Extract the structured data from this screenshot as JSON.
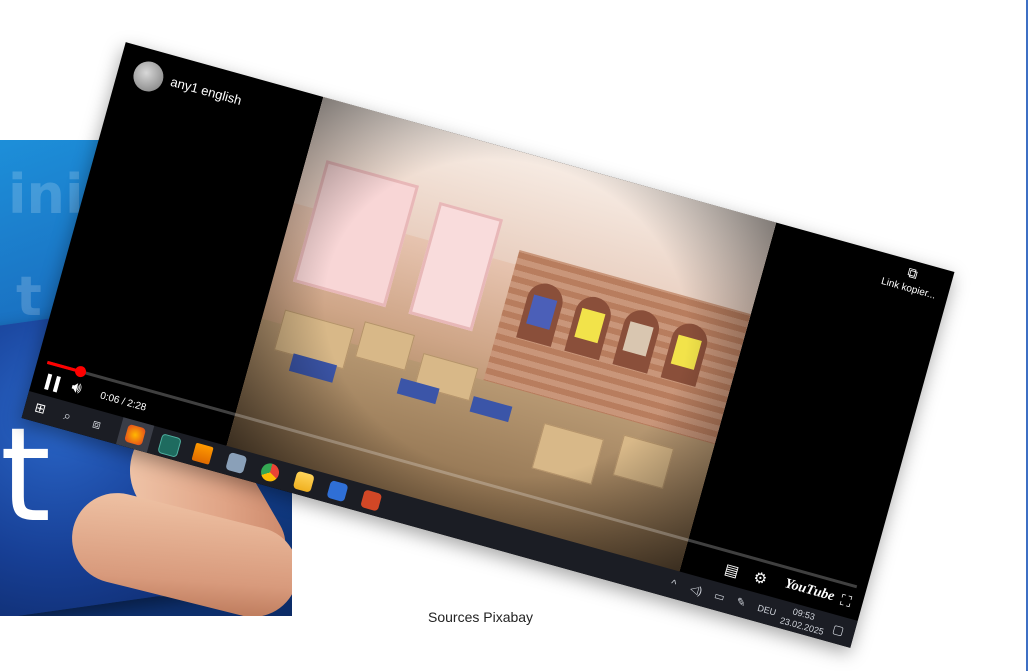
{
  "slide": {
    "caption": "Sources Pixabay",
    "accent_color": "#3d6fc4"
  },
  "background_image": {
    "description_icon": "puzzle-hand-photo",
    "puzzle_letter": "t"
  },
  "video_player": {
    "channel_name": "any1 english",
    "current_time": "0:06 / 2:28",
    "progress_fraction": 0.04,
    "copy_link_label": "Link kopier...",
    "youtube_label": "YouTube",
    "icons": {
      "pause": "pause-icon",
      "volume": "volume-icon",
      "copy": "copy-icon",
      "subtitles": "subtitles-icon",
      "settings": "gear-icon",
      "fullscreen": "fullscreen-icon"
    },
    "progress_color": "#ff0000"
  },
  "taskbar": {
    "language": "DEU",
    "time": "09:53",
    "date": "23.02.2025",
    "icons": [
      "windows-start-icon",
      "search-icon",
      "task-view-icon",
      "firefox-icon",
      "app-icon",
      "vlc-icon",
      "app-icon",
      "chrome-icon",
      "file-explorer-icon",
      "app-icon",
      "powerpoint-icon"
    ]
  }
}
